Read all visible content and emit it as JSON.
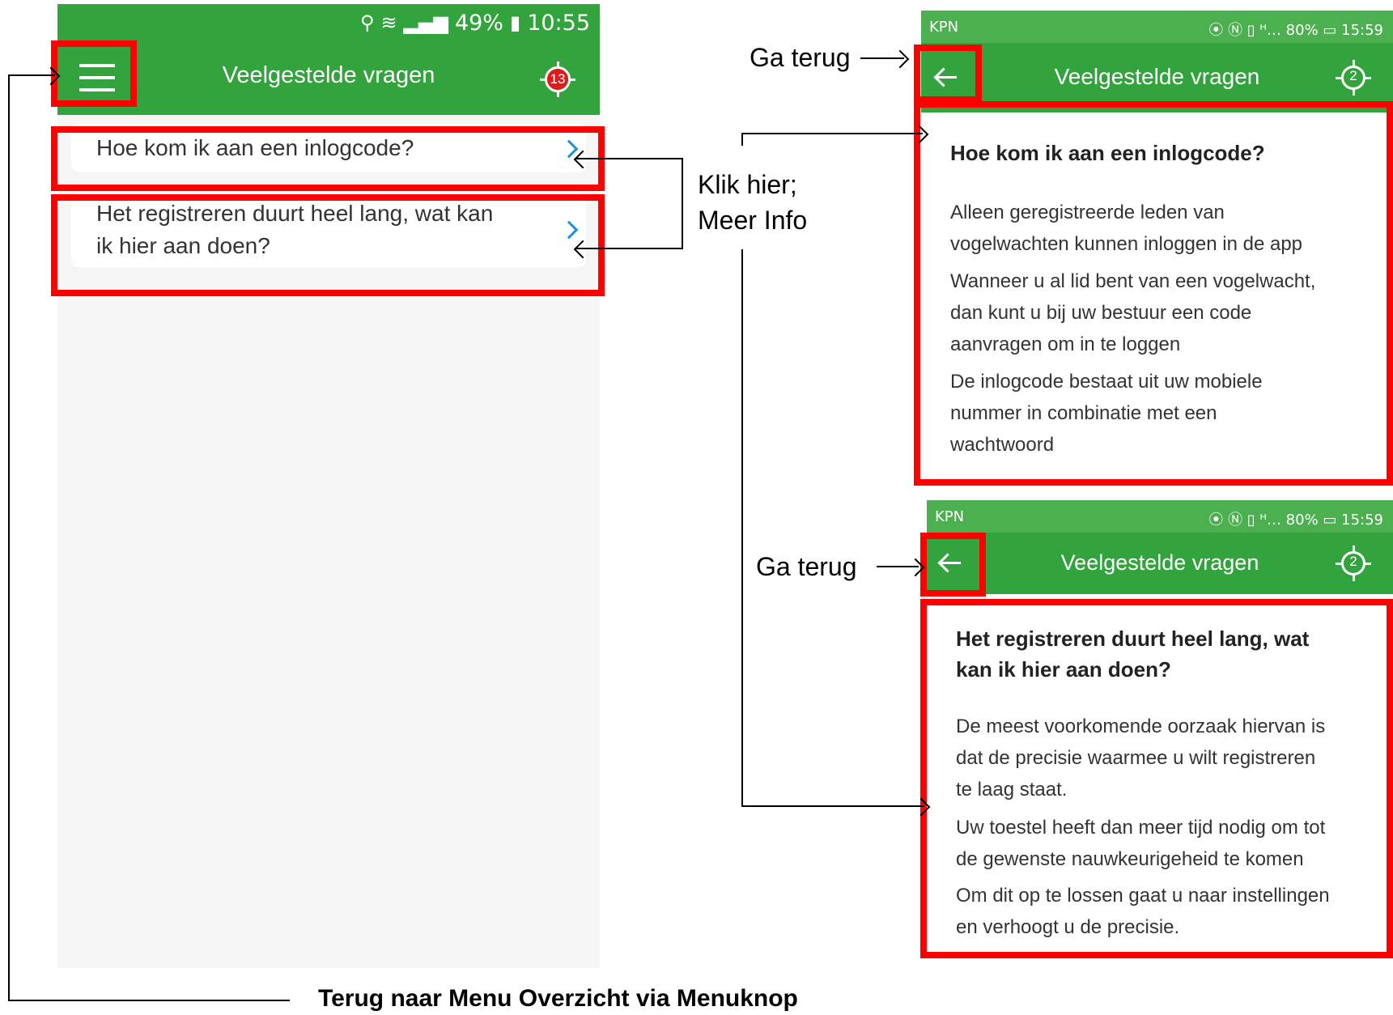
{
  "main_screen": {
    "status_bar": {
      "battery": "49%",
      "time": "10:55"
    },
    "app_bar": {
      "title": "Veelgestelde vragen",
      "menu_icon": "hamburger-menu-icon",
      "gps_badge_count": "13"
    },
    "faq_items": [
      {
        "question": "Hoe kom ik aan een inlogcode?"
      },
      {
        "question_line1": "Het registreren duurt heel lang, wat kan",
        "question_line2": "ik hier aan doen?"
      }
    ]
  },
  "detail_screen_login": {
    "status_bar": {
      "carrier": "KPN",
      "indicators": "⦿ Ⓝ ▯ ᴴ… 80% ▭ 15:59"
    },
    "app_bar": {
      "title": "Veelgestelde vragen",
      "gps_number": "2"
    },
    "title": "Hoe kom ik aan een inlogcode?",
    "paragraphs": [
      {
        "lines": [
          "Alleen geregistreerde leden van",
          "vogelwachten kunnen inloggen in de app"
        ]
      },
      {
        "lines": [
          "Wanneer u al lid bent van een vogelwacht,",
          "dan kunt u bij uw bestuur een code",
          "aanvragen om in te loggen"
        ]
      },
      {
        "lines": [
          "De inlogcode bestaat uit uw mobiele",
          "nummer in combinatie met een",
          "wachtwoord"
        ]
      }
    ]
  },
  "detail_screen_register": {
    "status_bar": {
      "carrier": "KPN",
      "indicators": "⦿ Ⓝ ▯ ᴴ… 80% ▭ 15:59"
    },
    "app_bar": {
      "title": "Veelgestelde vragen",
      "gps_number": "2"
    },
    "title_lines": [
      "Het registreren duurt heel lang, wat",
      "kan ik hier aan doen?"
    ],
    "paragraphs": [
      {
        "lines": [
          "De meest voorkomende oorzaak hiervan is",
          "dat de precisie waarmee u wilt registreren",
          "te laag staat."
        ]
      },
      {
        "lines": [
          "Uw toestel heeft dan meer tijd nodig om tot",
          "de gewenste nauwkeurigeheid te komen"
        ]
      },
      {
        "lines": [
          "Om dit op te lossen gaat u naar instellingen",
          "en verhoogt u de precisie."
        ]
      }
    ]
  },
  "annotations": {
    "back_top": "Ga terug",
    "back_bottom": "Ga terug",
    "click_here_line1": "Klik hier;",
    "click_here_line2": "Meer Info",
    "menu_back": "Terug naar Menu Overzicht via Menuknop"
  },
  "colors": {
    "green": "#33a33d",
    "highlight_red": "#ff0000",
    "chevron_blue": "#1a8fe0",
    "badge_red": "#e01b1b"
  }
}
